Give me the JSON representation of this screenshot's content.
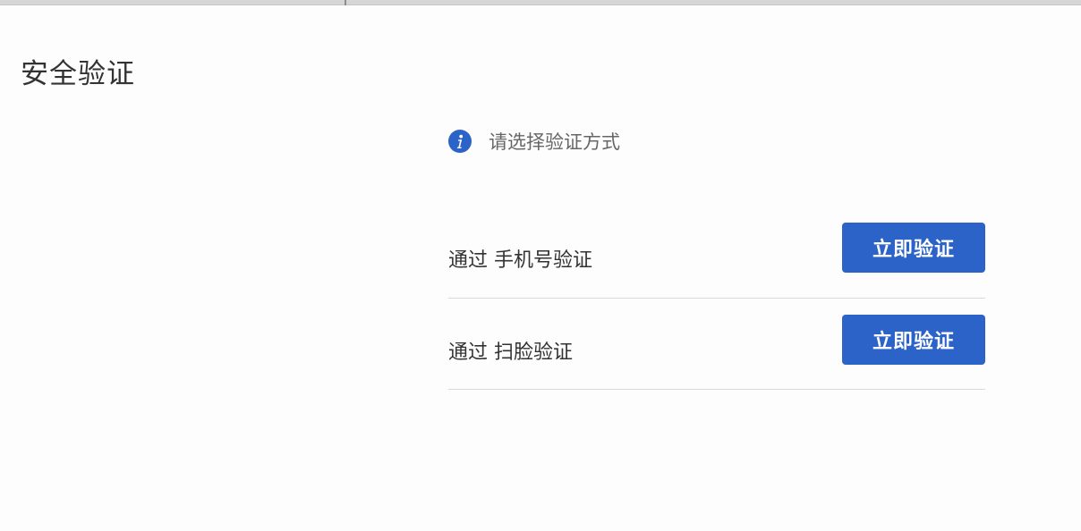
{
  "page": {
    "title": "安全验证"
  },
  "hint": {
    "icon": "info-icon",
    "text": "请选择验证方式"
  },
  "methods": [
    {
      "label": "通过 手机号验证",
      "button_label": "立即验证"
    },
    {
      "label": "通过 扫脸验证",
      "button_label": "立即验证"
    }
  ],
  "colors": {
    "accent": "#2b63c8",
    "text_primary": "#333333",
    "text_secondary": "#666666",
    "divider": "#d9d9d9"
  }
}
